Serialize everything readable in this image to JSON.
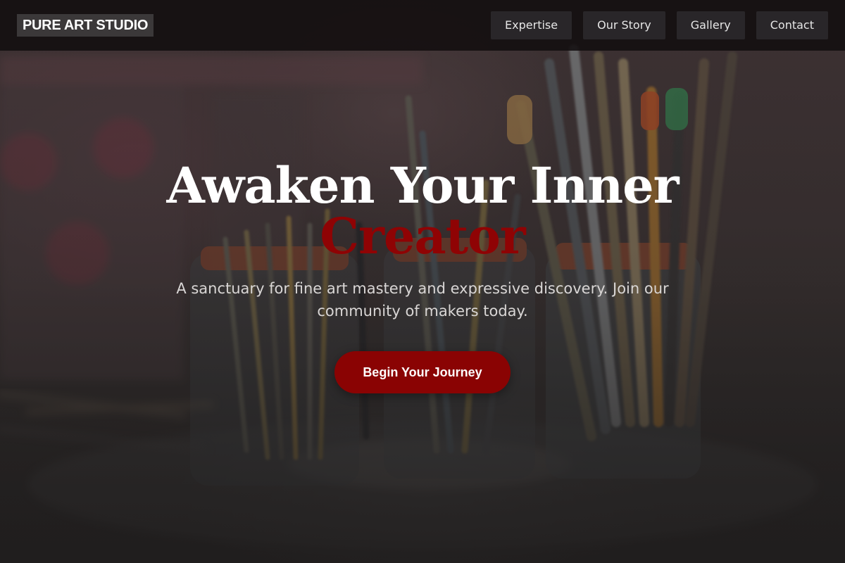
{
  "brand": {
    "name": "PURE ART STUDIO"
  },
  "nav": {
    "items": [
      {
        "label": "Expertise"
      },
      {
        "label": "Our Story"
      },
      {
        "label": "Gallery"
      },
      {
        "label": "Contact"
      }
    ]
  },
  "hero": {
    "headline_main": "Awaken Your Inner",
    "headline_accent": "Creator",
    "subtitle": "A sanctuary for fine art mastery and expressive discovery. Join our community of makers today.",
    "cta_label": "Begin Your Journey"
  },
  "colors": {
    "accent": "#8a0303",
    "navbar": "#120e0f",
    "text": "#ffffff"
  }
}
